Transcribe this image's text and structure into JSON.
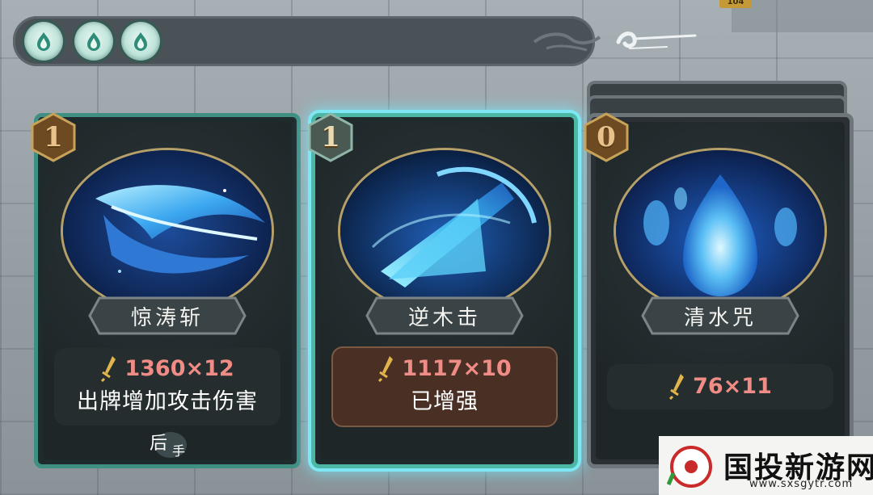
{
  "top": {
    "energy_orbs": 3,
    "badge": "104"
  },
  "cards": [
    {
      "cost": "1",
      "name": "惊涛斩",
      "damage": "1360×12",
      "effect": "出牌增加攻击伤害",
      "tag_line1": "后",
      "tag_line2": "手",
      "frame_color": "#3f8f82"
    },
    {
      "cost": "1",
      "name": "逆木击",
      "damage": "1117×10",
      "effect": "已增强",
      "frame_color": "#4db7a5",
      "selected": true
    },
    {
      "cost": "0",
      "name": "清水咒",
      "damage": "76×11",
      "frame_color": "#6d767b"
    }
  ],
  "watermark": {
    "text": "国投新游网",
    "url": "www.sxsgytr.com"
  }
}
